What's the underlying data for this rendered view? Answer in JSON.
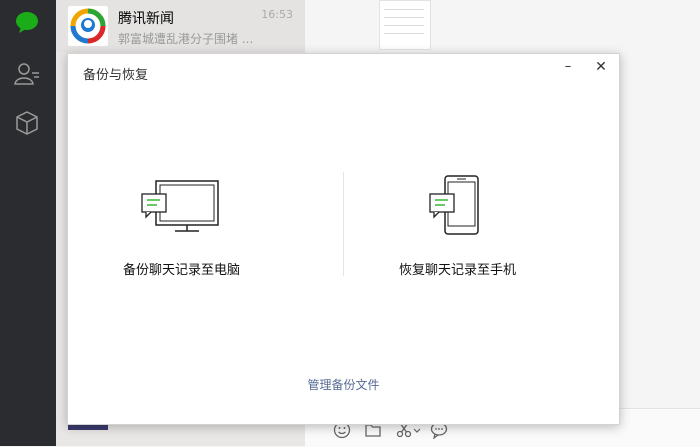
{
  "sidebar": {
    "items": [
      {
        "icon": "chat-bubble-icon",
        "active": true
      },
      {
        "icon": "contacts-icon",
        "active": false
      },
      {
        "icon": "cube-icon",
        "active": false
      }
    ],
    "accent": "#1aad19"
  },
  "chatlist": {
    "items": [
      {
        "name": "腾讯新闻",
        "time": "16:53",
        "preview": "郭富城遭乱港分子围堵 ..."
      }
    ]
  },
  "dialog": {
    "title": "备份与恢复",
    "minimize_label": "–",
    "close_label": "✕",
    "options": [
      {
        "label": "备份聊天记录至电脑",
        "icon": "monitor-chat-icon"
      },
      {
        "label": "恢复聊天记录至手机",
        "icon": "phone-chat-icon"
      }
    ],
    "manage_link": "管理备份文件"
  },
  "inputbar": {
    "tools": [
      "emoji-icon",
      "folder-icon",
      "scissors-icon",
      "chat-history-icon"
    ]
  }
}
